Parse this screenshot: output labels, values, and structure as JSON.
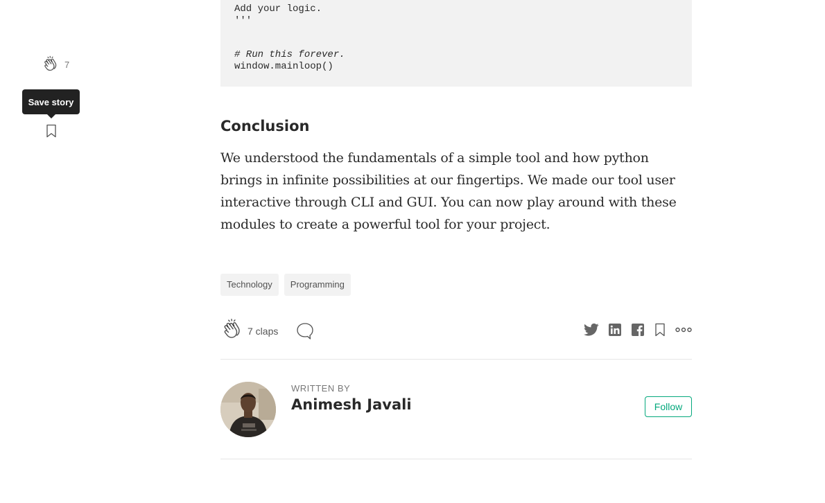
{
  "sidebar": {
    "clap_count": "7",
    "tooltip": "Save story"
  },
  "code_block": {
    "lines": [
      {
        "text": "Add your logic.",
        "style": "plain"
      },
      {
        "text": "'''",
        "style": "plain"
      },
      {
        "text": "",
        "style": "plain"
      },
      {
        "text": "",
        "style": "plain"
      },
      {
        "text": "# Run this forever.",
        "style": "comment"
      },
      {
        "text": "window.mainloop()",
        "style": "plain"
      }
    ]
  },
  "article": {
    "heading": "Conclusion",
    "paragraph": "We understood the fundamentals of a simple tool and how python brings in infinite possibilities at our fingertips. We made our tool user interactive through CLI and GUI. You can now play around with these modules to create a powerful tool for your project."
  },
  "tags": [
    "Technology",
    "Programming"
  ],
  "actions": {
    "claps_label": "7 claps"
  },
  "share_icons": [
    "twitter-icon",
    "linkedin-icon",
    "facebook-icon",
    "bookmark-icon",
    "more-icon"
  ],
  "author": {
    "written_by": "WRITTEN BY",
    "name": "Animesh Javali",
    "follow_label": "Follow"
  },
  "colors": {
    "accent": "#03a87c",
    "code_bg": "#f2f2f2",
    "tooltip_bg": "#222222"
  }
}
